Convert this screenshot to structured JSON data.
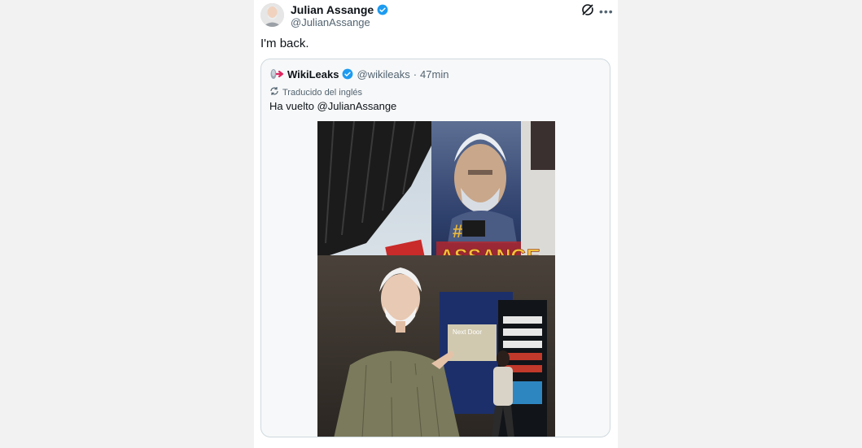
{
  "tweet": {
    "author_name": "Julian Assange",
    "author_handle": "@JulianAssange",
    "text": "I'm back."
  },
  "quoted": {
    "author_name": "WikiLeaks",
    "author_handle": "@wikileaks",
    "separator": "·",
    "time": "47min",
    "translated_label": "Traducido del inglés",
    "text": "Ha vuelto @JulianAssange",
    "photo": {
      "mural_text": "ASSANGE",
      "hash": "#",
      "shop_sign": "Next Door"
    }
  },
  "icons": {
    "verified": "verified-badge-icon",
    "grok": "grok-icon",
    "more": "more-icon",
    "translate": "translate-icon"
  },
  "colors": {
    "verified": "#1d9bf0",
    "secondary_text": "#536471",
    "border": "#cfd9de"
  }
}
